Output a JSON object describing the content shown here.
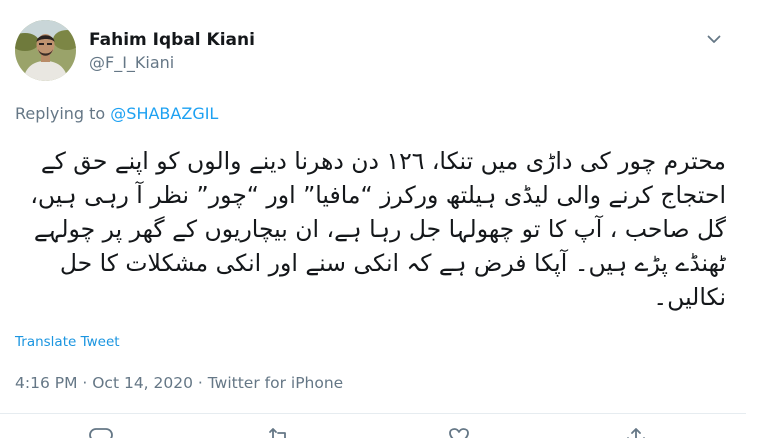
{
  "tweet": {
    "author": {
      "display_name": "Fahim Iqbal Kiani",
      "handle": "@F_I_Kiani",
      "avatar_icon": "profile-photo"
    },
    "replying_to": {
      "prefix": "Replying to",
      "mention": "@SHABAZGIL"
    },
    "text": "محترم چور کی داڑی میں تنکا، ۱۲٦ دن دھرنا دینے والوں کو اپنے حق کے احتجاج کرنے والی لیڈی ہیلتھ ورکرز “مافیا” اور “چور” نظر آ رہی ہیں، گل صاحب ، آپ کا تو چھولہا جل رہا ہے، ان بیچاریوں کے گھر پر چولہے ٹھنڈے پڑے ہیں۔ آپکا فرض ہے کہ انکی سنے اور انکی مشکلات کا حل نکالیں۔",
    "translate_label": "Translate Tweet",
    "timestamp": "4:16 PM · Oct 14, 2020 · Twitter for iPhone",
    "colors": {
      "link": "#1da1f2",
      "muted": "#657786",
      "divider": "#e6ecf0"
    },
    "actions": [
      "reply-icon",
      "retweet-icon",
      "like-icon",
      "share-icon"
    ]
  }
}
